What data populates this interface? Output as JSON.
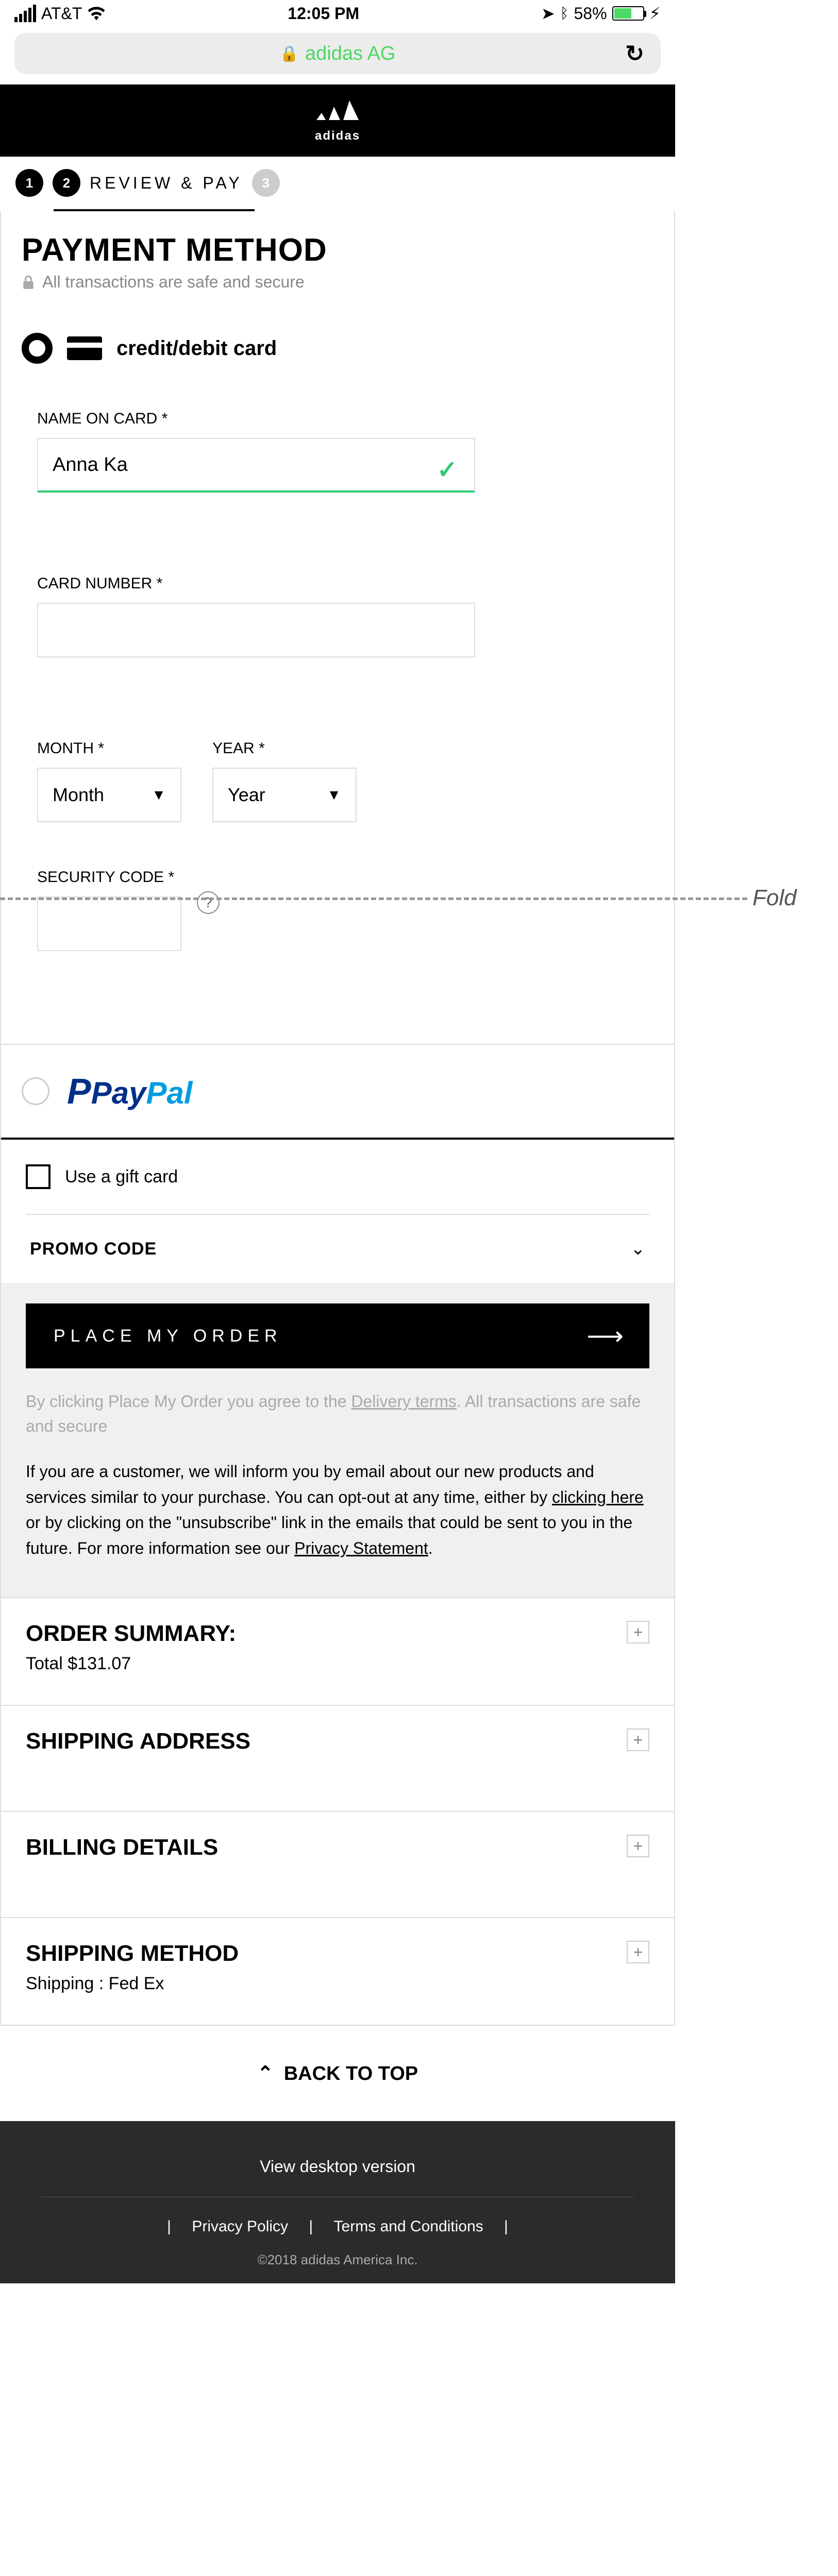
{
  "status": {
    "carrier": "AT&T",
    "time": "12:05 PM",
    "battery": "58%"
  },
  "browser": {
    "site": "adidas AG"
  },
  "logo": {
    "word": "adidas"
  },
  "stepper": {
    "s1": "1",
    "s2": "2",
    "label": "REVIEW & PAY",
    "s3": "3"
  },
  "payment": {
    "title": "PAYMENT METHOD",
    "sub": "All transactions are safe and secure",
    "card_label": "credit/debit card",
    "name_label": "NAME ON CARD *",
    "name_value": "Anna Ka",
    "number_label": "CARD NUMBER *",
    "month_label": "MONTH *",
    "month_value": "Month",
    "year_label": "YEAR *",
    "year_value": "Year",
    "sec_label": "SECURITY CODE *",
    "help": "?",
    "paypal_p": "Pay",
    "paypal_pal": "Pal"
  },
  "gift": {
    "label": "Use a gift card"
  },
  "promo": {
    "label": "PROMO CODE"
  },
  "order": {
    "btn": "PLACE MY ORDER",
    "disc1a": "By clicking Place My Order you agree to the ",
    "disc1b": " Delivery terms",
    "disc1c": ". All transactions are safe and secure",
    "disc2a": "If you are a customer, we will inform you by email about our new products and services similar to your purchase. You can opt-out at any time, either by ",
    "disc2b": "clicking here",
    "disc2c": " or by clicking on the \"unsubscribe\" link in the emails that could be sent to you in the future. For more information see our ",
    "disc2d": "Privacy Statement",
    "disc2e": "."
  },
  "summary": {
    "title": "ORDER SUMMARY:",
    "total": "Total  $131.07"
  },
  "shipaddr": {
    "title": "SHIPPING ADDRESS"
  },
  "billing": {
    "title": "BILLING DETAILS"
  },
  "shipmethod": {
    "title": "SHIPPING METHOD",
    "value": "Shipping : Fed Ex"
  },
  "backtop": "BACK TO TOP",
  "footer": {
    "desktop": "View desktop version",
    "priv": "Privacy Policy",
    "terms": "Terms and Conditions",
    "copy": "©2018 adidas America Inc."
  }
}
